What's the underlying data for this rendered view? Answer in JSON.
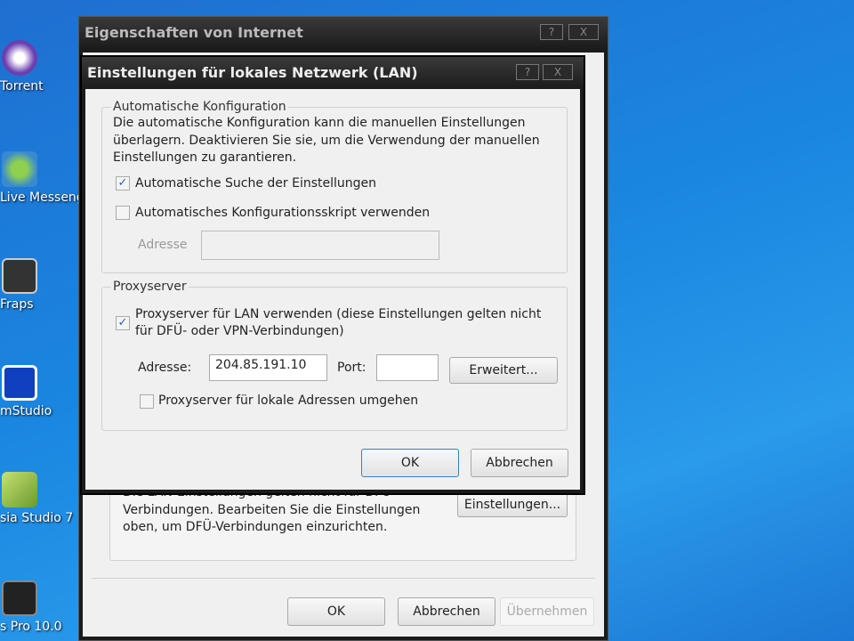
{
  "desktop": {
    "icons": [
      {
        "label": "Torrent"
      },
      {
        "label": "Live Messeng"
      },
      {
        "label": "Fraps"
      },
      {
        "label": "mStudio"
      },
      {
        "label": "sia Studio 7"
      },
      {
        "label": "s Pro 10.0"
      }
    ]
  },
  "outer": {
    "title": "Eigenschaften von Internet",
    "help": "?",
    "close": "X",
    "text_lines": [
      "Die LAN-Einstellungen gelten nicht für DFÜ-",
      "Verbindungen. Bearbeiten Sie die Einstellungen",
      "oben, um DFÜ-Verbindungen einzurichten."
    ],
    "settings_button": "Einstellungen...",
    "ok": "OK",
    "cancel": "Abbrechen",
    "apply": "Übernehmen"
  },
  "lan": {
    "title": "Einstellungen für lokales Netzwerk (LAN)",
    "help": "?",
    "close": "X",
    "auto": {
      "legend": "Automatische Konfiguration",
      "desc": [
        "Die automatische Konfiguration kann die manuellen Einstellungen",
        "überlagern. Deaktivieren Sie sie, um die Verwendung der manuellen",
        "Einstellungen zu garantieren."
      ],
      "auto_detect": {
        "label": "Automatische Suche der Einstellungen",
        "checked": true
      },
      "script": {
        "label": "Automatisches Konfigurationsskript verwenden",
        "checked": false
      },
      "address_label": "Adresse",
      "address_value": ""
    },
    "proxy": {
      "legend": "Proxyserver",
      "use": {
        "label1": "Proxyserver für LAN verwenden (diese Einstellungen gelten nicht",
        "label2": "für DFÜ- oder VPN-Verbindungen)",
        "checked": true
      },
      "address_label": "Adresse:",
      "address_value": "204.85.191.10",
      "port_label": "Port:",
      "port_value": "",
      "advanced": "Erweitert...",
      "bypass": {
        "label": "Proxyserver für lokale Adressen umgehen",
        "checked": false
      }
    },
    "ok": "OK",
    "cancel": "Abbrechen",
    "check": "✓"
  }
}
